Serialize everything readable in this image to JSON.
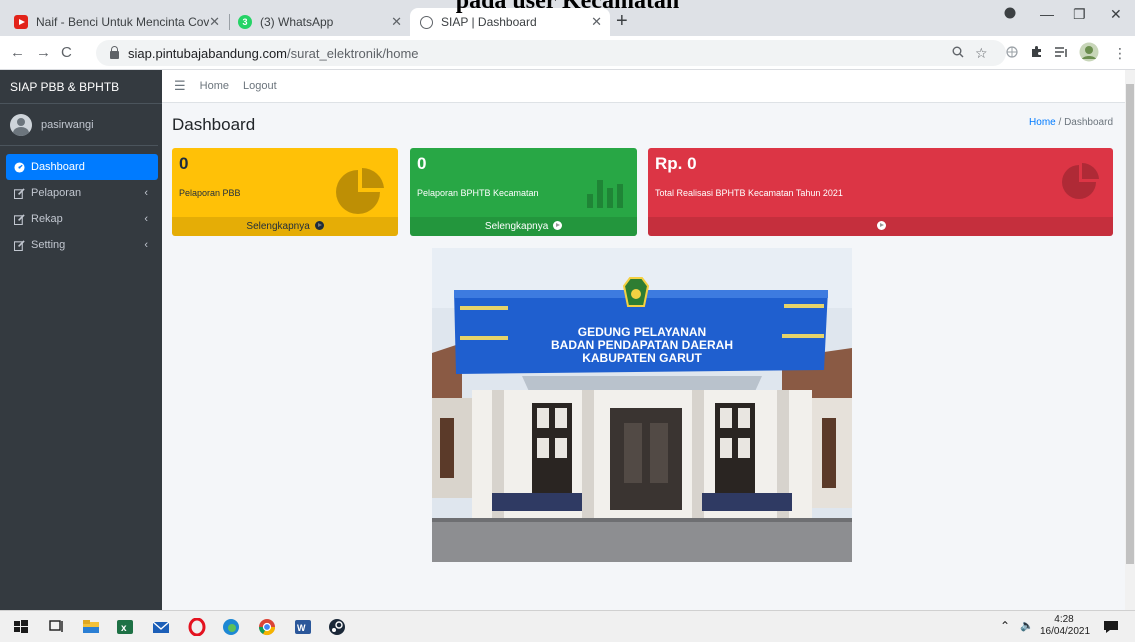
{
  "overlay_caption": "pada user Kecamatan",
  "browser": {
    "tabs": [
      {
        "title": "Naif - Benci Untuk Mencinta Cov",
        "favicon": "youtube-icon"
      },
      {
        "title": "(3) WhatsApp",
        "favicon": "whatsapp-icon"
      },
      {
        "title": "SIAP | Dashboard",
        "favicon": "globe-icon"
      }
    ],
    "url_host": "siap.pintubajabandung.com",
    "url_path": "/surat_elektronik/home"
  },
  "sidebar": {
    "brand": "SIAP PBB & BPHTB",
    "user": "pasirwangi",
    "items": [
      {
        "label": "Dashboard",
        "icon": "dashboard-icon"
      },
      {
        "label": "Pelaporan",
        "icon": "edit-icon"
      },
      {
        "label": "Rekap",
        "icon": "edit-icon"
      },
      {
        "label": "Setting",
        "icon": "edit-icon"
      }
    ],
    "active_color": "#007bff"
  },
  "topnav": {
    "home": "Home",
    "logout": "Logout"
  },
  "page": {
    "title": "Dashboard",
    "breadcrumb_home": "Home",
    "breadcrumb_current": "Dashboard"
  },
  "boxes": {
    "pbb": {
      "value": "0",
      "label": "Pelaporan PBB",
      "footer": "Selengkapnya",
      "color": "#ffc107",
      "icon": "pie-chart-icon"
    },
    "bphtb": {
      "value": "0",
      "label": "Pelaporan BPHTB Kecamatan",
      "footer": "Selengkapnya",
      "color": "#28a745",
      "icon": "bar-chart-icon"
    },
    "realisasi": {
      "value": "Rp. 0",
      "label": "Total Realisasi BPHTB Kecamatan Tahun 2021",
      "color": "#dc3545",
      "icon": "pie-chart-icon"
    }
  },
  "photo": {
    "sign_line1": "GEDUNG PELAYANAN",
    "sign_line2": "BADAN PENDAPATAN DAERAH",
    "sign_line3": "KABUPATEN GARUT"
  },
  "taskbar": {
    "time": "4:28",
    "date": "16/04/2021"
  }
}
